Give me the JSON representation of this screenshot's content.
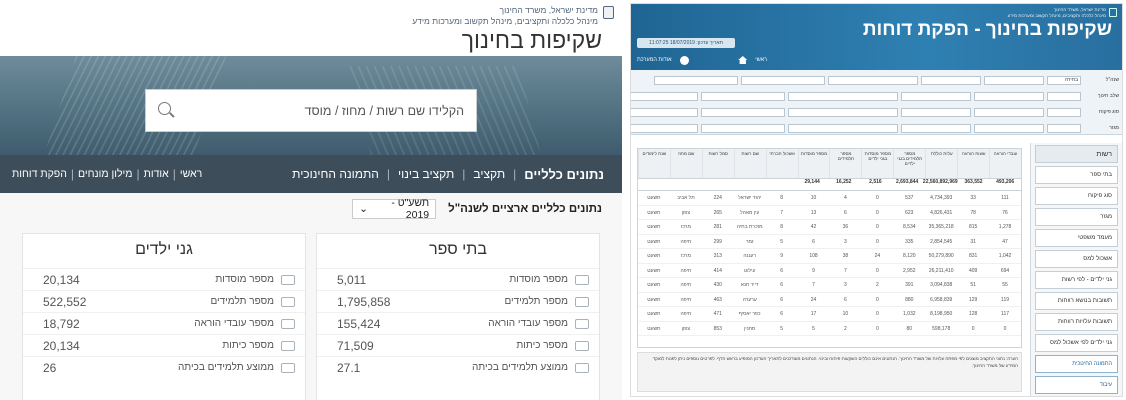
{
  "left": {
    "header": {
      "ministry_line1": "מדינת ישראל, משרד החינוך",
      "ministry_line2": "מינהל כלכלה ותקציבים, מינהל תקשוב ומערכות מידע",
      "title": "שקיפות בחינוך"
    },
    "search": {
      "placeholder": "הקלידו שם רשות / מחוז / מוסד"
    },
    "nav": {
      "items": [
        "נתונים כלליים",
        "תקציב",
        "תקציב בינוי",
        "התמונה החינוכית"
      ],
      "small": [
        "ראשי",
        "אודות",
        "מילון מונחים",
        "הפקת דוחות"
      ]
    },
    "subheader": {
      "label": "נתונים כלליים ארציים לשנה\"ל",
      "year_select": "תשע\"ט - 2019"
    },
    "schools": {
      "title": "בתי ספר",
      "rows": [
        {
          "label": "מספר מוסדות",
          "value": "5,011"
        },
        {
          "label": "מספר תלמידים",
          "value": "1,795,858"
        },
        {
          "label": "מספר עובדי הוראה",
          "value": "155,424"
        },
        {
          "label": "מספר כיתות",
          "value": "71,509"
        },
        {
          "label": "ממוצע תלמידים בכיתה",
          "value": "27.1"
        }
      ]
    },
    "kindergartens": {
      "title": "גני ילדים",
      "rows": [
        {
          "label": "מספר מוסדות",
          "value": "20,134"
        },
        {
          "label": "מספר תלמידים",
          "value": "522,552"
        },
        {
          "label": "מספר עובדי הוראה",
          "value": "18,792"
        },
        {
          "label": "מספר כיתות",
          "value": "20,134"
        },
        {
          "label": "ממוצע תלמידים בכיתה",
          "value": "26"
        }
      ]
    }
  },
  "right": {
    "header": {
      "line1": "מדינת ישראל, משרד החינוך",
      "line2": "מינהל כלכלה ותקציבים, מינהל תקשוב ומערכות מידע",
      "title": "שקיפות בחינוך - הפקת דוחות",
      "date": "תאריך עדכון: 18/07/2019 11:07:25",
      "nav_home": "ראשי",
      "nav_stats": "אודות המערכת"
    },
    "filters": {
      "rows": [
        {
          "label": "שנה\"ל",
          "select": "בחירה"
        },
        {
          "label": "שלב חינוך",
          "select": ""
        },
        {
          "label": "סוג פיקוח",
          "select": ""
        },
        {
          "label": "מגזר",
          "select": ""
        },
        {
          "label": "מעמד משפטי",
          "select": ""
        }
      ]
    },
    "sidebar": {
      "items": [
        "רשות",
        "בתי ספר",
        "סוג פיקוח",
        "מגזר",
        "מעמד משפטי",
        "אשכול למס",
        "גני ילדים - לפי רשות",
        "תשובות בנושא רווחות",
        "תשובות עלויות רווחות",
        "גני ילדים לפי אשכול למס"
      ],
      "bottom": [
        "התמונה החינוכית",
        "עיבוד"
      ]
    },
    "table": {
      "headers": [
        "שנת לימודים",
        "שם מחוז",
        "סמל רשות",
        "שם רשות",
        "אשכול חברתי",
        "מספר מוסדות",
        "מספר תלמידים",
        "מספר מוסדות בגני ילדים",
        "מספר תלמידים בגני ילדים",
        "עלות כוללת",
        "שעות הוראה",
        "עובדי הוראה"
      ],
      "totals": [
        "",
        "",
        "",
        "",
        "",
        "29,144",
        "16,252",
        "2,516",
        "2,693,844",
        "22,560,892,969",
        "363,552",
        "493,206"
      ],
      "rows": [
        [
          "תשעט",
          "תל אביב",
          "224",
          "יהוד ישראל",
          "8",
          "10",
          "4",
          "0",
          "537",
          "4,734,393",
          "33",
          "111"
        ],
        [
          "תשעט",
          "צפון",
          "265",
          "עין מאהל",
          "7",
          "13",
          "6",
          "0",
          "623",
          "4,826,431",
          "78",
          "76"
        ],
        [
          "תשעט",
          "מרכז",
          "281",
          "מזכרת בתיה",
          "8",
          "42",
          "36",
          "0",
          "8,534",
          "35,365,218",
          "815",
          "1,278"
        ],
        [
          "תשעט",
          "חיפה",
          "299",
          "זמר",
          "5",
          "6",
          "3",
          "0",
          "335",
          "2,854,545",
          "31",
          "47"
        ],
        [
          "תשעט",
          "מרכז",
          "313",
          "רעננה",
          "9",
          "108",
          "38",
          "24",
          "8,120",
          "50,279,890",
          "831",
          "1,042"
        ],
        [
          "תשעט",
          "חיפה",
          "414",
          "עילוט",
          "6",
          "9",
          "7",
          "0",
          "2,952",
          "26,211,410",
          "409",
          "694"
        ],
        [
          "תשעט",
          "חיפה",
          "430",
          "דייר חנא",
          "6",
          "7",
          "3",
          "2",
          "391",
          "3,094,838",
          "51",
          "55"
        ],
        [
          "תשעט",
          "חיפה",
          "463",
          "ערערה",
          "6",
          "24",
          "6",
          "0",
          "880",
          "6,958,839",
          "129",
          "119"
        ],
        [
          "תשעט",
          "חיפה",
          "471",
          "כפר יאסיף",
          "6",
          "17",
          "10",
          "0",
          "1,032",
          "8,198,950",
          "128",
          "117"
        ],
        [
          "תשעט",
          "צפון",
          "853",
          "סחנין",
          "5",
          "5",
          "2",
          "0",
          "80",
          "598,178",
          "0",
          "0"
        ]
      ]
    },
    "note": "הערה: נתוני התקציב מוצגים לפי מפתח עלויות של משרד החינוך. הנתונים אינם כוללים השקעות פיתוח ובינוי. הנתונים מעודכנים לתאריך העדכון המופיע בראש הדף. לפרטים נוספים ניתן לפנות למוקד המידע של משרד החינוך."
  }
}
